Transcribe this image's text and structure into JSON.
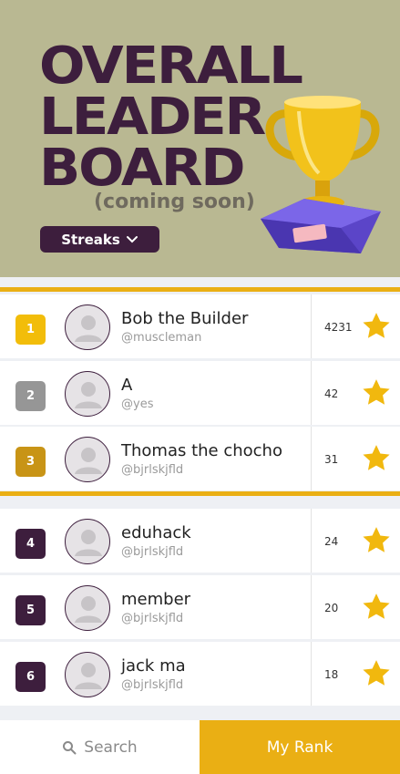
{
  "header": {
    "title_lines": [
      "OVERALL",
      "LEADER",
      "BOARD"
    ],
    "subtitle": "(coming soon)",
    "dropdown": {
      "label": "Streaks",
      "icon": "chevron-down-icon"
    },
    "trophy_icon": "trophy-icon"
  },
  "leaderboard": [
    {
      "rank": "1",
      "name": "Bob the Builder",
      "handle": "@muscleman",
      "score": "4231"
    },
    {
      "rank": "2",
      "name": "A",
      "handle": "@yes",
      "score": "42"
    },
    {
      "rank": "3",
      "name": "Thomas the chocho",
      "handle": "@bjrlskjfld",
      "score": "31"
    },
    {
      "rank": "4",
      "name": "eduhack",
      "handle": "@bjrlskjfld",
      "score": "24"
    },
    {
      "rank": "5",
      "name": "member",
      "handle": "@bjrlskjfld",
      "score": "20"
    },
    {
      "rank": "6",
      "name": "jack ma",
      "handle": "@bjrlskjfld",
      "score": "18"
    }
  ],
  "bottom_bar": {
    "search_label": "Search",
    "search_icon": "search-icon",
    "my_rank_label": "My Rank"
  },
  "colors": {
    "header_bg": "#b9b892",
    "title": "#3d1e3d",
    "accent": "#eaaf14",
    "gold": "#f2bd0a",
    "silver": "#969696",
    "bronze": "#c89416",
    "dark_rank": "#3d1e3d"
  }
}
